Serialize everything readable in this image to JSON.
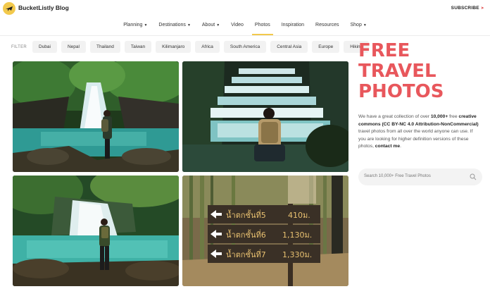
{
  "header": {
    "site_title": "BucketListly Blog",
    "subscribe_label": "SUBSCRIBE",
    "logo_icon": "airplane-icon"
  },
  "nav": {
    "items": [
      {
        "label": "Planning",
        "dropdown": true
      },
      {
        "label": "Destinations",
        "dropdown": true
      },
      {
        "label": "About",
        "dropdown": true
      },
      {
        "label": "Video",
        "dropdown": false
      },
      {
        "label": "Photos",
        "dropdown": false,
        "active": true
      },
      {
        "label": "Inspiration",
        "dropdown": false
      },
      {
        "label": "Resources",
        "dropdown": false
      },
      {
        "label": "Shop",
        "dropdown": true
      }
    ]
  },
  "filter": {
    "label": "FILTER",
    "chips": [
      "Dubai",
      "Nepal",
      "Thailand",
      "Taiwan",
      "Kilimanjaro",
      "Africa",
      "South America",
      "Central Asia",
      "Europe",
      "Hiking"
    ]
  },
  "hero": {
    "title_line1": "FREE",
    "title_line2": "TRAVEL",
    "title_line3": "PHOTOS",
    "desc_1": "We have a great collection of over ",
    "desc_b1": "10,000+",
    "desc_2": " free ",
    "desc_b2": "creative commons (CC BY-NC 4.0 Attribution-NonCommercial)",
    "desc_3": " travel photos from all over the world anyone can use. If you are looking for higher definition versions of these photos, ",
    "desc_b3": "contact me",
    "desc_4": "."
  },
  "search": {
    "placeholder": "Search 10,000+ Free Travel Photos"
  },
  "sign": {
    "line1": "น้ำตกชั้นที่5",
    "dist1": "410ม.",
    "line2": "น้ำตกชั้นที่6",
    "dist2": "1,130ม.",
    "line3": "น้ำตกชั้นที่7",
    "dist3": "1,330ม."
  },
  "colors": {
    "accent_yellow": "#f2c94c",
    "hero_red": "#e8575c"
  }
}
